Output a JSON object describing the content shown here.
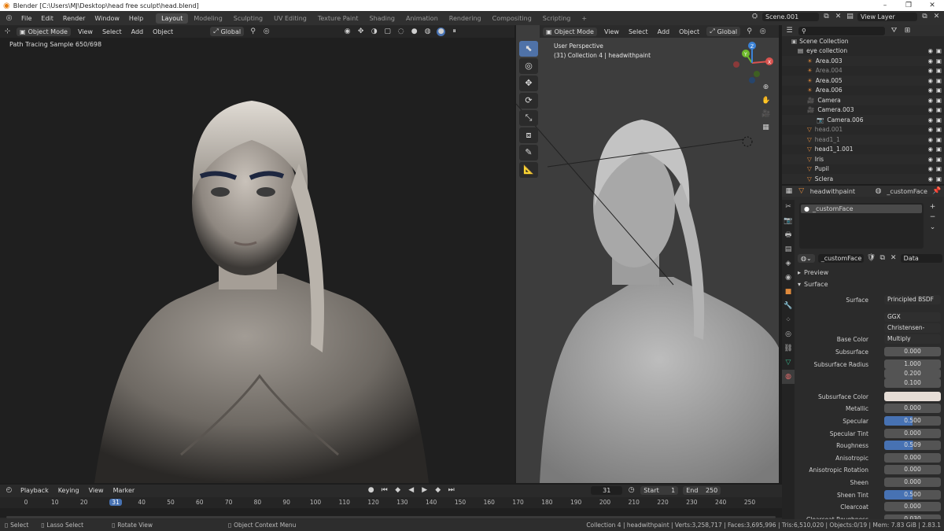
{
  "window": {
    "title": "Blender [C:\\Users\\MJ\\Desktop\\head free sculpt\\head.blend]",
    "controls": [
      "–",
      "❐",
      "✕"
    ]
  },
  "menu": {
    "items": [
      "File",
      "Edit",
      "Render",
      "Window",
      "Help"
    ],
    "workspaces": [
      "Layout",
      "Modeling",
      "Sculpting",
      "UV Editing",
      "Texture Paint",
      "Shading",
      "Animation",
      "Rendering",
      "Compositing",
      "Scripting"
    ],
    "active_workspace": "Layout",
    "add_tab": "+",
    "scene": "Scene.001",
    "view_layer": "View Layer"
  },
  "left_viewport": {
    "mode": "Object Mode",
    "menus": [
      "View",
      "Select",
      "Add",
      "Object"
    ],
    "transform": "Global",
    "overlay_text": "Path Tracing Sample 650/698"
  },
  "right_viewport": {
    "mode": "Object Mode",
    "menus": [
      "View",
      "Select",
      "Add",
      "Object"
    ],
    "transform": "Global",
    "perspective": "User Perspective",
    "collection_info": "(31) Collection 4 | headwithpaint",
    "tools": [
      "select-cursor-icon",
      "cursor-icon",
      "move-icon",
      "rotate-icon",
      "scale-icon",
      "transform-icon",
      "annotate-icon",
      "measure-icon"
    ],
    "gizmo_axes": [
      "X",
      "Y",
      "Z"
    ]
  },
  "outliner": {
    "root": "Scene Collection",
    "rows": [
      {
        "name": "eye collection",
        "indent": 0,
        "kind": "collection",
        "dim": false
      },
      {
        "name": "Area.003",
        "indent": 1,
        "kind": "light",
        "dim": false
      },
      {
        "name": "Area.004",
        "indent": 1,
        "kind": "light",
        "dim": true
      },
      {
        "name": "Area.005",
        "indent": 1,
        "kind": "light",
        "dim": false
      },
      {
        "name": "Area.006",
        "indent": 1,
        "kind": "light",
        "dim": false
      },
      {
        "name": "Camera",
        "indent": 1,
        "kind": "camera",
        "dim": false
      },
      {
        "name": "Camera.003",
        "indent": 1,
        "kind": "camera",
        "dim": false
      },
      {
        "name": "Camera.006",
        "indent": 2,
        "kind": "camera-data",
        "dim": false
      },
      {
        "name": "head.001",
        "indent": 1,
        "kind": "mesh",
        "dim": true
      },
      {
        "name": "head1_1",
        "indent": 1,
        "kind": "mesh",
        "dim": true
      },
      {
        "name": "head1_1.001",
        "indent": 1,
        "kind": "mesh",
        "dim": false
      },
      {
        "name": "Iris",
        "indent": 1,
        "kind": "mesh",
        "dim": false
      },
      {
        "name": "Pupil",
        "indent": 1,
        "kind": "mesh",
        "dim": false
      },
      {
        "name": "Sclera",
        "indent": 1,
        "kind": "mesh",
        "dim": false
      }
    ]
  },
  "properties": {
    "object_name": "headwithpaint",
    "material_name": "_customFace",
    "slot": "_customFace",
    "link_mode": "Data",
    "sections": {
      "preview": "Preview",
      "surface": "Surface"
    },
    "surface_shader": "Principled BSDF",
    "distribution": "GGX",
    "subsurface_method": "Christensen-Burley",
    "fields": [
      {
        "label": "Base Color",
        "value": "Multiply",
        "type": "node"
      },
      {
        "label": "Subsurface",
        "value": "0.000",
        "type": "num"
      },
      {
        "label": "Subsurface Radius",
        "value": "1.000",
        "type": "num"
      },
      {
        "label": "",
        "value": "0.200",
        "type": "num"
      },
      {
        "label": "",
        "value": "0.100",
        "type": "num"
      },
      {
        "label": "Subsurface Color",
        "value": "",
        "type": "color"
      },
      {
        "label": "Metallic",
        "value": "0.000",
        "type": "num"
      },
      {
        "label": "Specular",
        "value": "0.500",
        "type": "slider",
        "fill": 0.5
      },
      {
        "label": "Specular Tint",
        "value": "0.000",
        "type": "num"
      },
      {
        "label": "Roughness",
        "value": "0.509",
        "type": "slider",
        "fill": 0.509
      },
      {
        "label": "Anisotropic",
        "value": "0.000",
        "type": "num"
      },
      {
        "label": "Anisotropic Rotation",
        "value": "0.000",
        "type": "num"
      },
      {
        "label": "Sheen",
        "value": "0.000",
        "type": "num"
      },
      {
        "label": "Sheen Tint",
        "value": "0.500",
        "type": "slider",
        "fill": 0.5
      },
      {
        "label": "Clearcoat",
        "value": "0.000",
        "type": "num"
      },
      {
        "label": "Clearcoat Roughness",
        "value": "0.030",
        "type": "num"
      }
    ],
    "subsurface_color": "#e6ddd6",
    "surface_label": "Surface"
  },
  "timeline": {
    "menus": [
      "Playback",
      "Keying",
      "View",
      "Marker"
    ],
    "current_frame": "31",
    "start_label": "Start",
    "start": "1",
    "end_label": "End",
    "end": "250",
    "ticks": [
      "0",
      "10",
      "20",
      "31",
      "40",
      "50",
      "60",
      "70",
      "80",
      "90",
      "100",
      "110",
      "120",
      "130",
      "140",
      "150",
      "160",
      "170",
      "180",
      "190",
      "200",
      "210",
      "220",
      "230",
      "240",
      "250"
    ]
  },
  "status": {
    "select": "Select",
    "lasso": "Lasso Select",
    "rotate": "Rotate View",
    "context": "Object Context Menu",
    "stats": "Collection 4 | headwithpaint | Verts:3,258,717 | Faces:3,695,996 | Tris:6,510,020 | Objects:0/19 | Mem: 7.83 GiB | 2.83.1"
  },
  "colors": {
    "accent": "#4772b3",
    "light": "#e08a3c",
    "mesh": "#e08a3c",
    "data": "#3bb28a"
  }
}
